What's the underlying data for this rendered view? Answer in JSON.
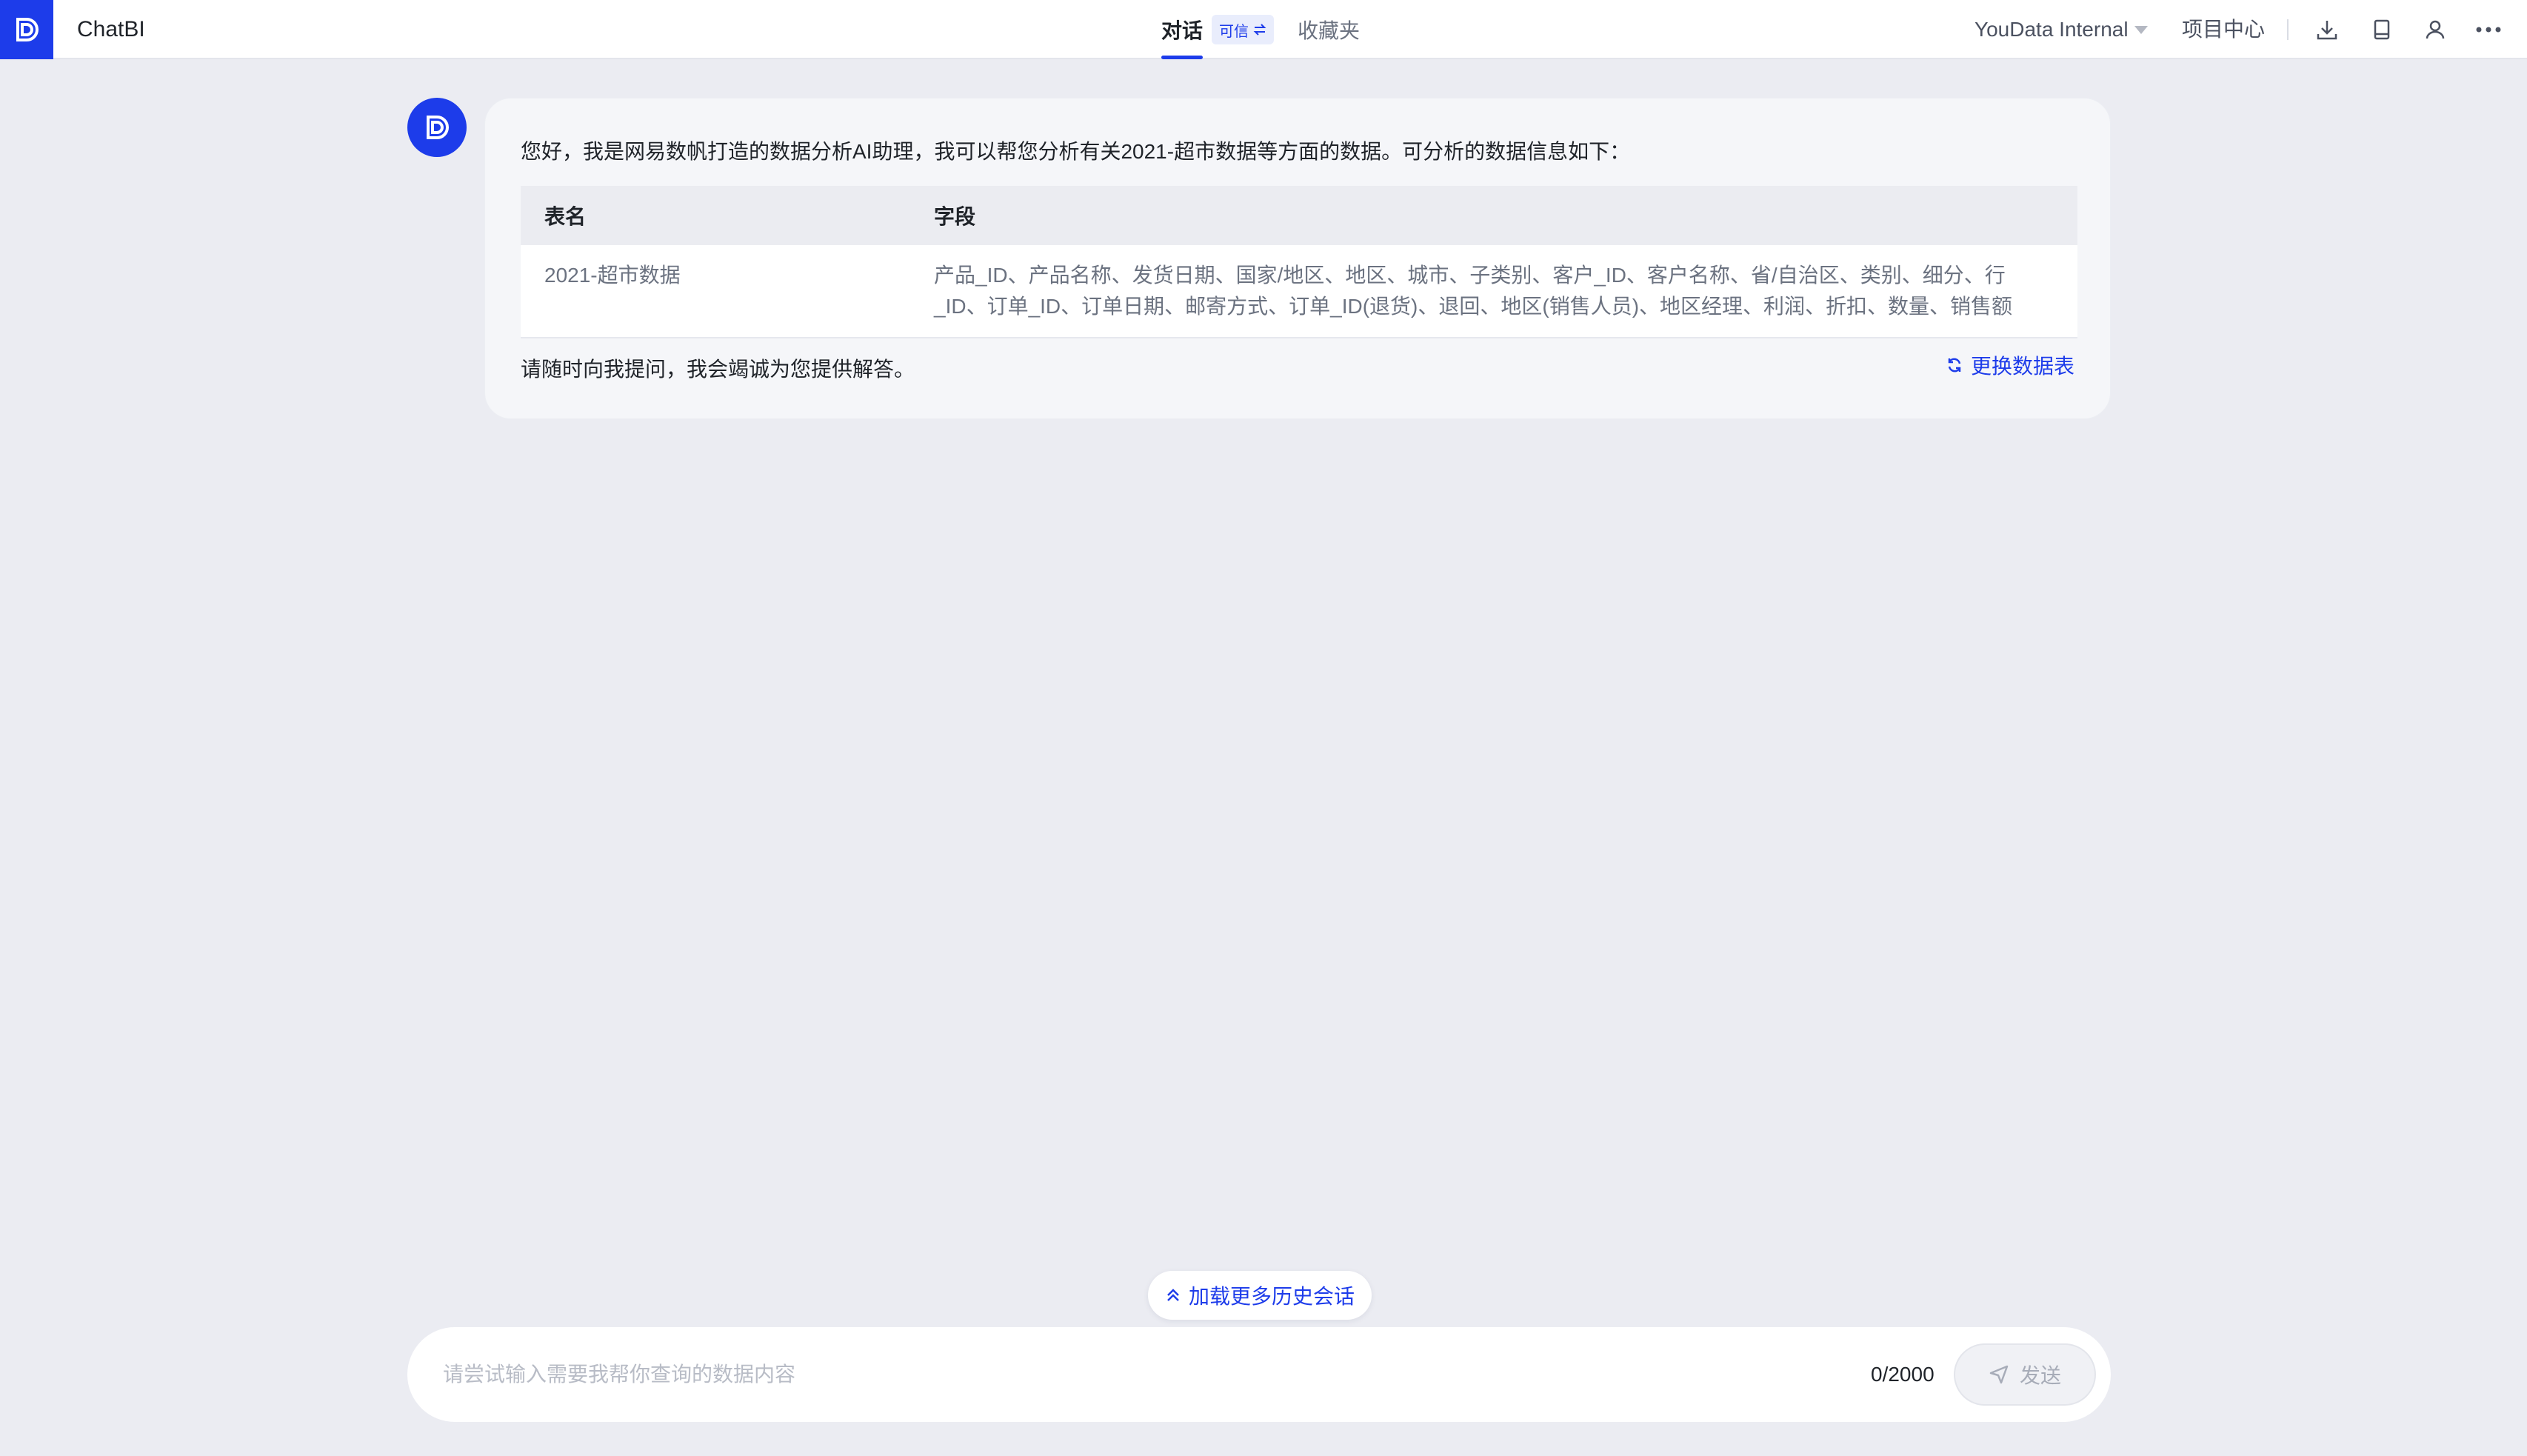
{
  "header": {
    "app_name": "ChatBI",
    "tabs": [
      {
        "label": "对话",
        "active": true
      },
      {
        "label": "收藏夹",
        "active": false
      }
    ],
    "trust_badge": "可信",
    "org_name": "YouData Internal",
    "project_center": "项目中心",
    "icons": [
      "download-icon",
      "book-icon",
      "user-icon",
      "more-icon"
    ]
  },
  "message": {
    "greeting": "您好，我是网易数帆打造的数据分析AI助理，我可以帮您分析有关2021-超市数据等方面的数据。可分析的数据信息如下：",
    "table": {
      "headers": [
        "表名",
        "字段"
      ],
      "rows": [
        {
          "name": "2021-超市数据",
          "fields": "产品_ID、产品名称、发货日期、国家/地区、地区、城市、子类别、客户_ID、客户名称、省/自治区、类别、细分、行_ID、订单_ID、订单日期、邮寄方式、订单_ID(退货)、退回、地区(销售人员)、地区经理、利润、折扣、数量、销售额"
        }
      ]
    },
    "footer_note": "请随时向我提问，我会竭诚为您提供解答。",
    "switch_table": "更换数据表"
  },
  "load_more": "加载更多历史会话",
  "composer": {
    "placeholder": "请尝试输入需要我帮你查询的数据内容",
    "value": "",
    "char_count": "0/2000",
    "send_label": "发送"
  },
  "colors": {
    "accent": "#1d3cea",
    "background": "#ebecf2"
  }
}
